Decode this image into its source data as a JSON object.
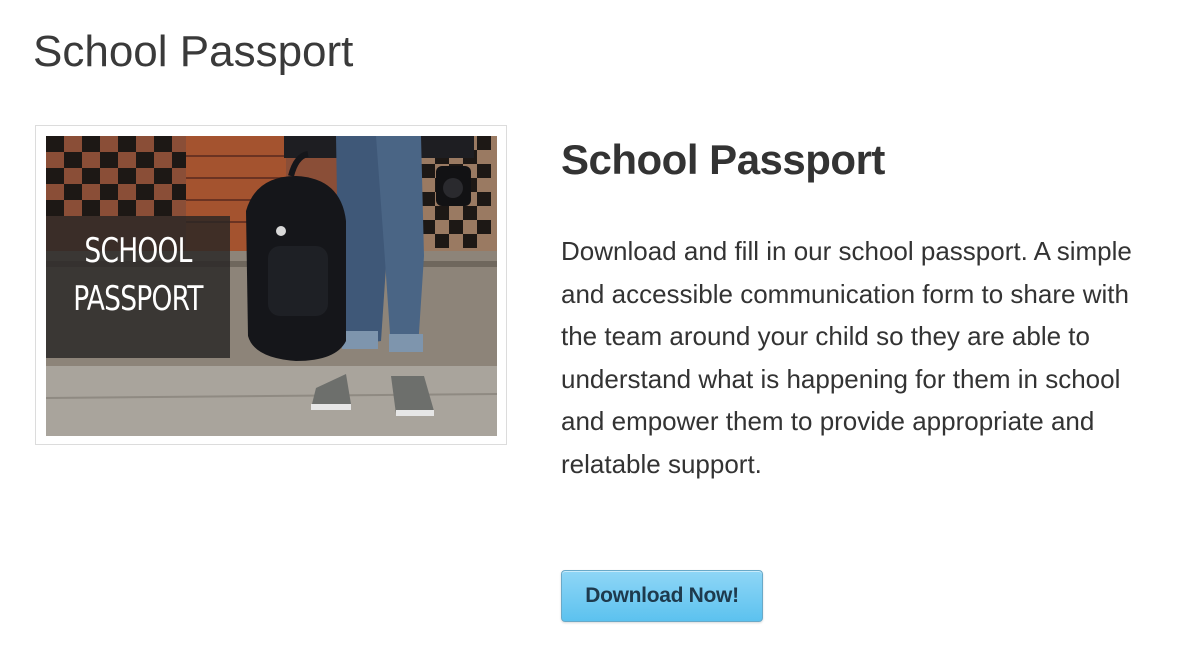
{
  "page": {
    "title": "School Passport"
  },
  "feature_image": {
    "overlay_line_1": "SCHOOL",
    "overlay_line_2": "PASSPORT",
    "icon": "photo-student-with-backpack"
  },
  "content": {
    "title": "School Passport",
    "description": "Download and fill in our school passport. A simple and accessible communication form to share with the team around your child so they are able to understand what is happening for them in school and empower them to provide appropriate and relatable support.",
    "button_label": "Download Now!"
  },
  "colors": {
    "button_top": "#8fd6f6",
    "button_bottom": "#5cc2ef",
    "button_text": "#1e3a4d",
    "text": "#333333"
  }
}
